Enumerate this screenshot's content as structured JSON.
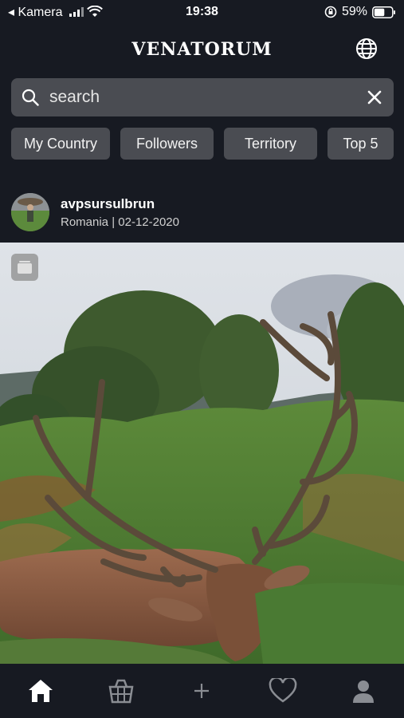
{
  "status_bar": {
    "carrier": "◂ Kamera",
    "time": "19:38",
    "battery": "59%"
  },
  "header": {
    "title": "VENATORUM",
    "globe_icon": "globe-icon"
  },
  "search": {
    "placeholder": "search",
    "value": ""
  },
  "filters": [
    {
      "label": "My Country"
    },
    {
      "label": "Followers"
    },
    {
      "label": "Territory"
    },
    {
      "label": "Top 5"
    }
  ],
  "post": {
    "username": "avpsursulbrun",
    "location_date": "Romania | 02-12-2020",
    "image_subject": "red deer stag in ferns"
  },
  "tab_bar": {
    "items": [
      "home-icon",
      "shop-basket-icon",
      "add-icon",
      "heart-icon",
      "profile-icon"
    ]
  },
  "colors": {
    "background": "#171a22",
    "control": "#4a4c52"
  }
}
